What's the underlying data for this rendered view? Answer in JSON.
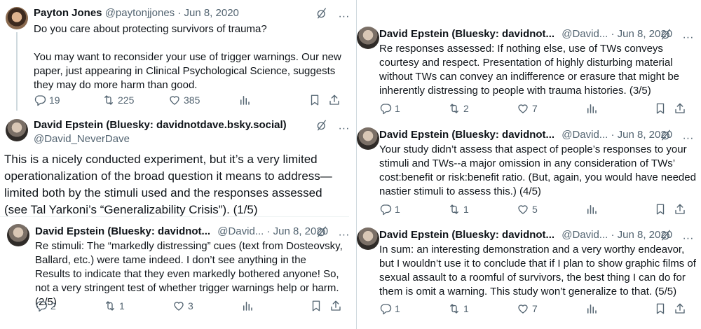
{
  "left": {
    "tweet1": {
      "name": "Payton Jones",
      "handle_date": "@paytonjjones · Jun 8, 2020",
      "text": "Do you care about protecting survivors of trauma?\n\nYou may want to reconsider your use of trigger warnings. Our new paper, just appearing in Clinical Psychological Science, suggests they may do more harm than good.",
      "replies": "19",
      "retweets": "225",
      "likes": "385"
    },
    "tweet2": {
      "name": "David Epstein (Bluesky: davidnotdave.bsky.social)",
      "handle": "@David_NeverDave",
      "text": "This is a nicely conducted experiment, but it’s a very limited operationalization of the broad question it means to address—limited both by the stimuli used and the responses assessed (see Tal Yarkoni’s “Generalizability Crisis”). (1/5)"
    },
    "tweet3": {
      "name": "David Epstein (Bluesky: davidnot...",
      "handle_date": "@David... · Jun 8, 2020",
      "text": "Re stimuli: The “markedly distressing” cues (text from Dosteovsky, Ballard, etc.) were tame indeed. I don’t see anything in the Results to indicate that they even markedly bothered anyone! So, not a very stringent test of whether trigger warnings help or harm. (2/5)",
      "replies": "2",
      "retweets": "1",
      "likes": "3"
    }
  },
  "right": {
    "tweet4": {
      "name": "David Epstein (Bluesky: davidnot...",
      "handle_date": "@David... · Jun 8, 2020",
      "text": "Re responses assessed:  If nothing else, use of TWs conveys courtesy and respect. Presentation of highly disturbing material without TWs can convey an indifference or erasure that might be inherently distressing to people with trauma histories. (3/5)",
      "replies": "1",
      "retweets": "2",
      "likes": "7"
    },
    "tweet5": {
      "name": "David Epstein (Bluesky: davidnot...",
      "handle_date": "@David... · Jun 8, 2020",
      "text": "Your study didn’t assess that aspect of people’s responses to your stimuli and TWs--a major omission in any consideration of TWs’ cost:benefit or risk:benefit ratio.  (But, again, you would have needed nastier stimuli to assess this.) (4/5)",
      "replies": "1",
      "retweets": "1",
      "likes": "5"
    },
    "tweet6": {
      "name": "David Epstein (Bluesky: davidnot...",
      "handle_date": "@David... · Jun 8, 2020",
      "text": "In sum: an interesting demonstration and a very worthy endeavor, but I wouldn’t use it to conclude that if I plan to show graphic films of sexual assault to a roomful of survivors, the best thing I can do for them is omit a warning. This study won’t generalize to that. (5/5)",
      "replies": "1",
      "retweets": "1",
      "likes": "7"
    }
  },
  "icons": {
    "grok": "grok-icon",
    "more": "more-icon",
    "reply": "reply-icon",
    "retweet": "retweet-icon",
    "like": "like-icon",
    "views": "views-icon",
    "bookmark": "bookmark-icon",
    "share": "share-icon",
    "more_glyph": "···"
  },
  "colors": {
    "text": "#0f1419",
    "secondary": "#536471",
    "divider": "#cfd9de"
  }
}
